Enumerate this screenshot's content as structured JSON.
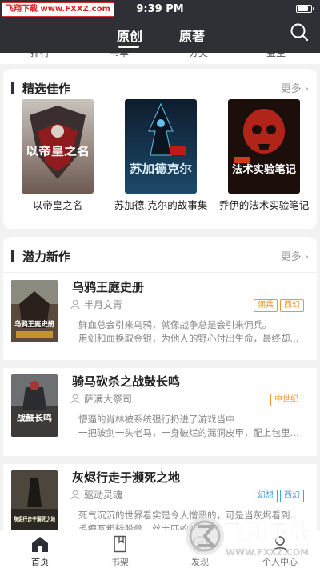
{
  "status_bar": {
    "time": "9:39 PM",
    "battery_level": 0.85
  },
  "watermark_top": "飞翔下载 www.FXXZ.com",
  "header": {
    "tabs": [
      {
        "label": "原创",
        "active": true
      },
      {
        "label": "原著",
        "active": false
      }
    ],
    "search_icon": "search-icon"
  },
  "category_row": [
    "排行",
    "书单",
    "分类",
    "金主"
  ],
  "featured": {
    "title": "精选佳作",
    "more_label": "更多",
    "books": [
      {
        "title": "以帝皇之名",
        "cover_text": "以帝皇之名"
      },
      {
        "title": "苏加德.克尔的故事集",
        "cover_text": "苏加德克尔"
      },
      {
        "title": "乔伊的法术实验笔记",
        "cover_text": "法术实验笔记"
      }
    ]
  },
  "new_works": {
    "title": "潜力新作",
    "more_label": "更多",
    "books": [
      {
        "title": "乌鸦王庭史册",
        "author": "半月文青",
        "tags": [
          {
            "label": "佣兵",
            "color": "orange"
          },
          {
            "label": "西幻",
            "color": "orange"
          }
        ],
        "desc_lines": [
          "鲜血总会引来乌鸦，就像战争总是会引来佣兵。",
          "用剑和血换取金银，为他人的野心付出生命，最终却..."
        ],
        "cover_text": "乌鸦王庭史册"
      },
      {
        "title": "骑马砍杀之战鼓长鸣",
        "author": "萨满大祭司",
        "tags": [
          {
            "label": "中世纪",
            "color": "orange"
          }
        ],
        "desc_lines": [
          "懵逼的肖林被系统强行扔进了游戏当中",
          "一把破剑一头老马，一身破烂的漏洞皮甲，配上包里的..."
        ],
        "cover_text": "战鼓长鸣"
      },
      {
        "title": "灰烬行走于濒死之地",
        "author": "驱动灵魂",
        "tags": [
          {
            "label": "幻想",
            "color": "blue"
          },
          {
            "label": "西幻",
            "color": "blue"
          }
        ],
        "desc_lines": [
          "死气沉沉的世界看实是令人憎恶的，可是当灰烬看到闪出",
          "毛癞瓦粗糙股骨，丝土匹的肚腿时..."
        ],
        "cover_text": "灰烬行走于濒死之地"
      }
    ]
  },
  "bottom_nav": [
    {
      "label": "首页",
      "icon": "home-icon",
      "active": true
    },
    {
      "label": "书架",
      "icon": "bookshelf-icon",
      "active": false
    },
    {
      "label": "发现",
      "icon": "discover-icon",
      "active": false
    },
    {
      "label": "个人中心",
      "icon": "user-icon",
      "active": false
    }
  ],
  "watermark_bottom": {
    "brand": "飞翔下载",
    "url": "WWW.FXXZ.COM"
  }
}
